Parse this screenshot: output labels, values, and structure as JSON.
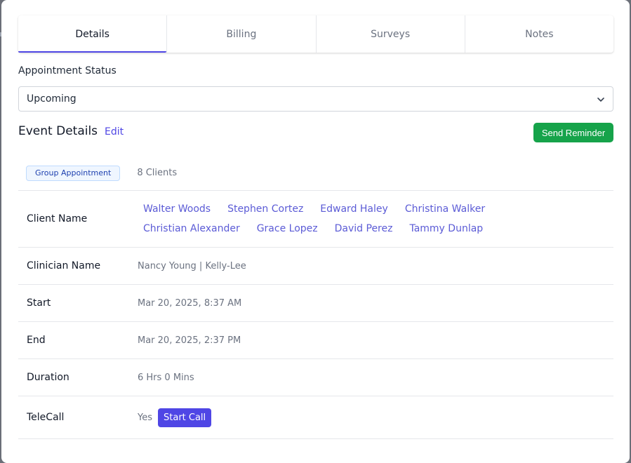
{
  "tabs": [
    {
      "label": "Details"
    },
    {
      "label": "Billing"
    },
    {
      "label": "Surveys"
    },
    {
      "label": "Notes"
    }
  ],
  "status": {
    "label": "Appointment Status",
    "value": "Upcoming"
  },
  "event": {
    "title": "Event Details",
    "edit_label": "Edit",
    "send_reminder_label": "Send Reminder",
    "badge": "Group Appointment",
    "clients_count": "8 Clients"
  },
  "rows": {
    "client_name_label": "Client Name",
    "clients": [
      "Walter Woods",
      "Stephen Cortez",
      "Edward Haley",
      "Christina Walker",
      "Christian Alexander",
      "Grace Lopez",
      "David Perez",
      "Tammy Dunlap"
    ],
    "clinician_label": "Clinician Name",
    "clinician_value": "Nancy Young | Kelly-Lee",
    "start_label": "Start",
    "start_value": "Mar 20, 2025, 8:37 AM",
    "end_label": "End",
    "end_value": "Mar 20, 2025, 2:37 PM",
    "duration_label": "Duration",
    "duration_value": "6 Hrs 0 Mins",
    "telecall_label": "TeleCall",
    "telecall_value": "Yes",
    "start_call_label": "Start Call"
  },
  "icons": {
    "select_arrow": "chevron-down-icon"
  },
  "colors": {
    "accent": "#4f46e5",
    "success": "#16a34a",
    "link": "#5b5bd6"
  }
}
